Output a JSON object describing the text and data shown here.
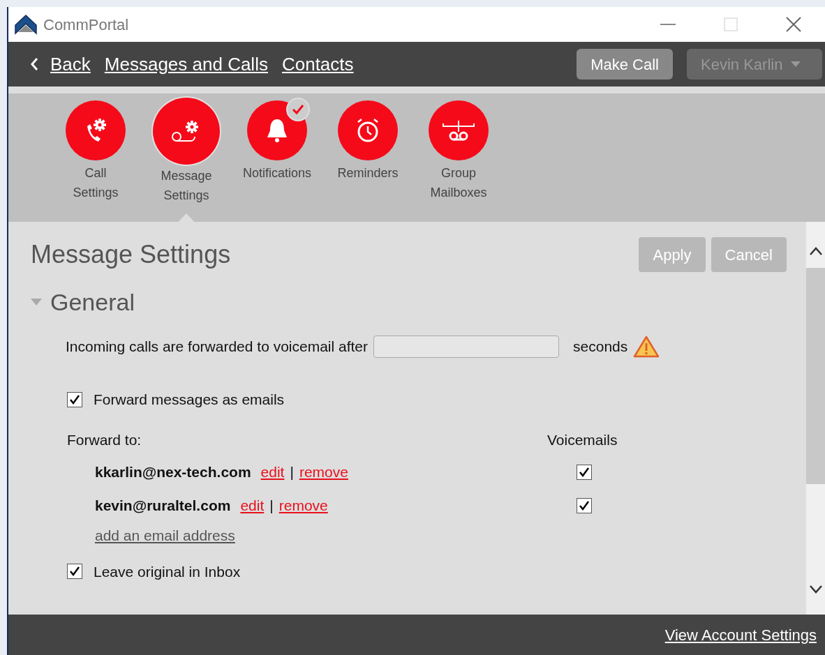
{
  "window": {
    "title": "CommPortal"
  },
  "nav": {
    "back": "Back",
    "links": [
      "Messages and Calls",
      "Contacts"
    ],
    "make_call": "Make Call",
    "user_menu": "Kevin Karlin"
  },
  "categories": [
    {
      "kind": "call",
      "label": [
        "Call",
        "Settings"
      ],
      "selected": false,
      "badge": false
    },
    {
      "kind": "message",
      "label": [
        "Message",
        "Settings"
      ],
      "selected": true,
      "badge": false
    },
    {
      "kind": "notifications",
      "label": [
        "Notifications"
      ],
      "selected": false,
      "badge": true
    },
    {
      "kind": "reminders",
      "label": [
        "Reminders"
      ],
      "selected": false,
      "badge": false
    },
    {
      "kind": "group",
      "label": [
        "Group",
        "Mailboxes"
      ],
      "selected": false,
      "badge": false
    }
  ],
  "page": {
    "title": "Message Settings",
    "buttons": [
      {
        "label": "Apply",
        "disabled": true
      },
      {
        "label": "Cancel",
        "disabled": true
      }
    ],
    "section": {
      "title": "General",
      "expanded": true,
      "forward_after": {
        "before": "Incoming calls are forwarded to voicemail after",
        "after": "seconds",
        "warning": true
      },
      "forward_as_email": {
        "label": "Forward messages as emails",
        "checked": true
      },
      "forward_to": "Forward to:",
      "voicemails_header": "Voicemails",
      "emails": [
        {
          "address": "kkarlin@nex-tech.com",
          "edit": "edit",
          "separator": "|",
          "remove": "remove",
          "voicemails": true
        },
        {
          "address": "kevin@ruraltel.com",
          "edit": "edit",
          "separator": "|",
          "remove": "remove",
          "voicemails": true
        }
      ],
      "add_email": "add an email address",
      "leave_original": {
        "label": "Leave original in Inbox",
        "checked": true
      }
    }
  },
  "footer": {
    "link": "View Account Settings"
  }
}
